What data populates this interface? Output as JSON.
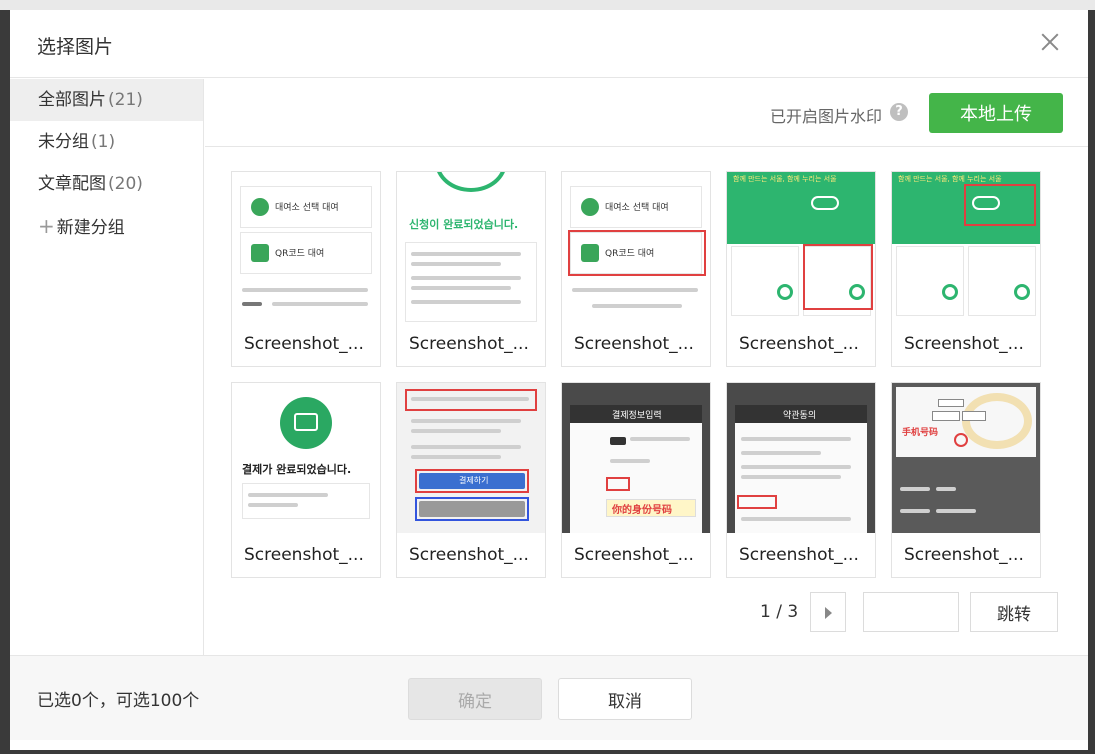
{
  "dialog": {
    "title": "选择图片",
    "close_icon": "close-icon"
  },
  "sidebar": {
    "groups": [
      {
        "label": "全部图片",
        "count": "(21)"
      },
      {
        "label": "未分组",
        "count": "(1)"
      },
      {
        "label": "文章配图",
        "count": "(20)"
      }
    ],
    "new_group_label": "新建分组",
    "new_group_icon": "plus-icon"
  },
  "toolbar": {
    "watermark_label": "已开启图片水印",
    "help_icon": "question-icon",
    "upload_label": "本地上传",
    "upload_color": "#44b549"
  },
  "images": [
    {
      "caption": "Screenshot_..."
    },
    {
      "caption": "Screenshot_..."
    },
    {
      "caption": "Screenshot_..."
    },
    {
      "caption": "Screenshot_..."
    },
    {
      "caption": "Screenshot_..."
    },
    {
      "caption": "Screenshot_..."
    },
    {
      "caption": "Screenshot_..."
    },
    {
      "caption": "Screenshot_..."
    },
    {
      "caption": "Screenshot_..."
    },
    {
      "caption": "Screenshot_..."
    }
  ],
  "thumb_text": {
    "t1_row1": "대여소 선택 대여",
    "t1_row2": "QR코드 대여",
    "t2_title": "신청이 완료되었습니다.",
    "t3_row1": "대여소 선택 대여",
    "t3_row2": "QR코드 대여",
    "t4_banner": "함께 만드는 서울, 함께 누리는 서울",
    "t5_banner": "함께 만드는 서울, 함께 누리는 서울",
    "t6_title": "결제가 완료되었습니다.",
    "t7_btn": "결제하기",
    "t8_title": "결제정보입력",
    "t8_note": "你的身份号码",
    "t9_title": "약관동의",
    "t10_note": "手机号码"
  },
  "pagination": {
    "current": "1 / 3",
    "next_icon": "caret-right-icon",
    "jump_label": "跳转"
  },
  "footer": {
    "selection_status": "已选0个，可选100个",
    "confirm_label": "确定",
    "cancel_label": "取消"
  }
}
